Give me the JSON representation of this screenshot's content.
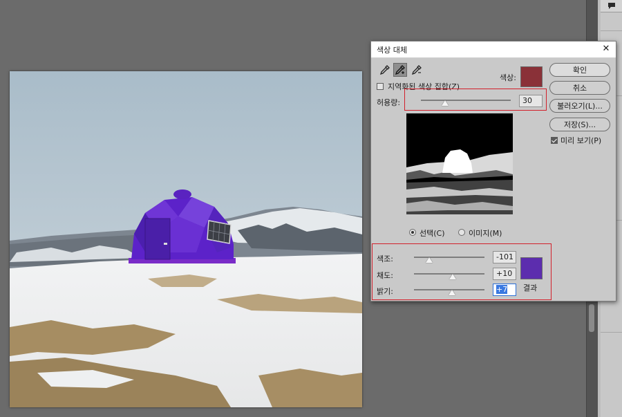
{
  "dialog": {
    "title": "색상 대체",
    "color_label": "색상:",
    "localized_label": "지역화된 색상 집합(Z)",
    "localized_checked": false,
    "fuzziness_label": "허용량:",
    "fuzziness_value": "30",
    "fuzziness_position": 0.27,
    "selection_radio_label": "선택(C)",
    "image_radio_label": "이미지(M)",
    "selected_radio": "selection",
    "picked_color": "#8a3138",
    "result_color": "#5c2dae",
    "result_label": "결과",
    "buttons": {
      "ok": "확인",
      "cancel": "취소",
      "load": "불러오기(L)...",
      "save": "저장(S)...",
      "preview": "미리 보기(P)"
    },
    "preview_checked": true,
    "replacement": {
      "hue_label": "색조:",
      "hue_value": "-101",
      "hue_position": 0.22,
      "saturation_label": "채도:",
      "saturation_value": "+10",
      "saturation_position": 0.55,
      "lightness_label": "밝기:",
      "lightness_value": "+7",
      "lightness_position": 0.54
    },
    "tools": [
      "eyedropper-icon",
      "eyedropper-plus-icon",
      "eyedropper-minus-icon"
    ],
    "active_tool": "eyedropper-plus-icon"
  },
  "colors": {
    "workspace": "#6b6b6b",
    "dialog_bg": "#c9c9c9",
    "highlight_box": "#d21f2a"
  }
}
